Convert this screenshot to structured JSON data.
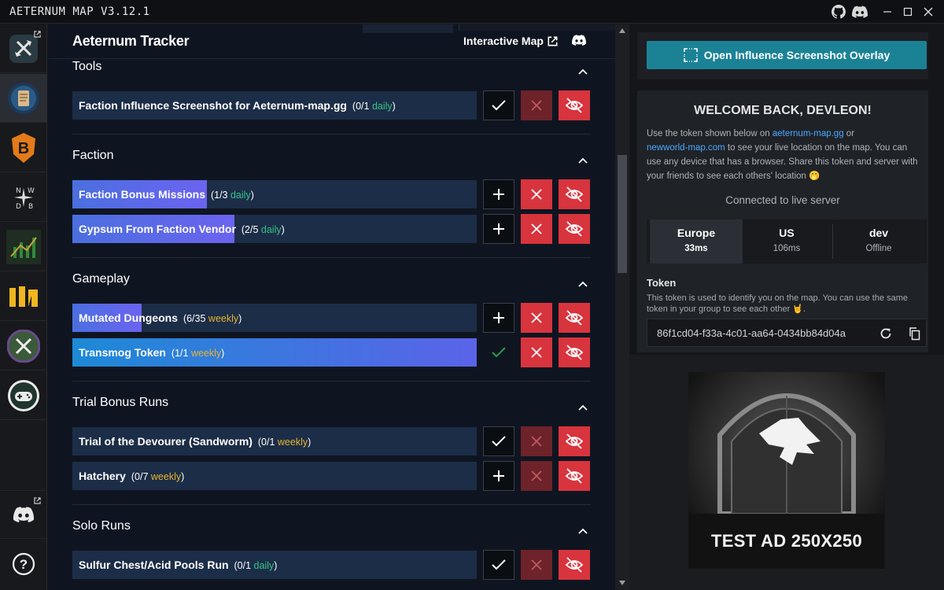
{
  "app": {
    "title": "AETERNUM MAP V3.12.1",
    "window_controls": [
      "github-icon",
      "discord-icon",
      "minimize-icon",
      "maximize-icon",
      "close-icon"
    ]
  },
  "sidebar": {
    "items": [
      {
        "name": "aeternum-map-app-icon",
        "external": true
      },
      {
        "name": "aeternum-tracker-app-icon",
        "active": true
      },
      {
        "name": "b-logo-app-icon"
      },
      {
        "name": "nwdb-app-icon"
      },
      {
        "name": "chart-app-icon"
      },
      {
        "name": "m-logo-app-icon"
      },
      {
        "name": "axes-app-icon"
      },
      {
        "name": "gamepad-app-icon"
      }
    ],
    "bottom": [
      {
        "name": "discord-icon",
        "external": true
      },
      {
        "name": "help-icon"
      }
    ]
  },
  "main": {
    "title": "Aeternum Tracker",
    "map_link": "Interactive Map",
    "sections": [
      {
        "title": "Tools",
        "tasks": [
          {
            "name": "Faction Influence Screenshot for Aeternum-map.gg",
            "count": "(0/1",
            "period": "daily",
            "close": ")",
            "progress": 0,
            "action": "check",
            "dismiss": "dim"
          }
        ]
      },
      {
        "title": "Faction",
        "tasks": [
          {
            "name": "Faction Bonus Missions",
            "count": "(1/3",
            "period": "daily",
            "close": ")",
            "progress": 0.333,
            "action": "plus",
            "dismiss": "red"
          },
          {
            "name": "Gypsum From Faction Vendor",
            "count": "(2/5",
            "period": "daily",
            "close": ")",
            "progress": 0.4,
            "action": "plus",
            "dismiss": "red"
          }
        ]
      },
      {
        "title": "Gameplay",
        "tasks": [
          {
            "name": "Mutated Dungeons",
            "count": "(6/35",
            "period": "weekly",
            "close": ")",
            "progress": 0.171,
            "action": "plus",
            "dismiss": "red"
          },
          {
            "name": "Transmog Token",
            "count": "(1/1",
            "period": "weekly",
            "close": ")",
            "progress": 1,
            "action": "done",
            "dismiss": "red"
          }
        ]
      },
      {
        "title": "Trial Bonus Runs",
        "tasks": [
          {
            "name": "Trial of the Devourer (Sandworm)",
            "count": "(0/1",
            "period": "weekly",
            "close": ")",
            "progress": 0,
            "action": "check",
            "dismiss": "dim"
          },
          {
            "name": "Hatchery",
            "count": "(0/7",
            "period": "weekly",
            "close": ")",
            "progress": 0,
            "action": "plus",
            "dismiss": "dim"
          }
        ]
      },
      {
        "title": "Solo Runs",
        "tasks": [
          {
            "name": "Sulfur Chest/Acid Pools Run",
            "count": "(0/1",
            "period": "daily",
            "close": ")",
            "progress": 0,
            "action": "check",
            "dismiss": "dim"
          }
        ]
      }
    ]
  },
  "right": {
    "overlay_button": "Open Influence Screenshot Overlay",
    "welcome_title": "WELCOME BACK, DEVLEON!",
    "welcome_text": {
      "p1": "Use the token shown below on ",
      "link1": "aeternum-map.gg",
      "p2": " or ",
      "link2": "newworld-map.com",
      "p3": " to see your live location on the map. You can use any device that has a browser. Share this token and server with your friends to see each others' location 🤭"
    },
    "connection_status": "Connected to live server",
    "servers": [
      {
        "name": "Europe",
        "status": "33ms",
        "active": true
      },
      {
        "name": "US",
        "status": "106ms",
        "active": false
      },
      {
        "name": "dev",
        "status": "Offline",
        "active": false
      }
    ],
    "token_label": "Token",
    "token_help": "This token is used to identify you on the map. You can use the same token in your group to see each other 🤘.",
    "token_value": "86f1cd04-f33a-4c01-aa64-0434bb84d04a",
    "ad_text": "TEST AD 250X250"
  },
  "colors": {
    "accent_teal": "#1b8296",
    "red": "#d8343e",
    "daily": "#35c38a",
    "weekly": "#e6b431",
    "progress": "#5b63e8"
  }
}
